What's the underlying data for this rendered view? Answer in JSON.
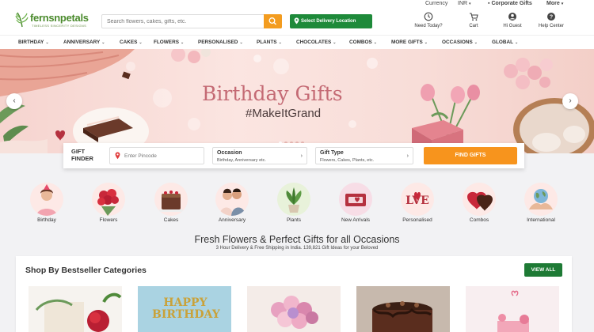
{
  "top_strip": {
    "currency_label": "Currency",
    "currency_value": "INR",
    "corporate": "Corporate Gifts",
    "more": "More"
  },
  "header": {
    "logo_text": "fernsnpetals",
    "logo_tagline": "TIMELESS SINCERITY DESIGNS",
    "search_placeholder": "Search flowers, cakes, gifts, etc.",
    "delivery_label": "Select Delivery Location",
    "actions": [
      {
        "label": "Need Today?",
        "icon": "clock-icon"
      },
      {
        "label": "Cart",
        "icon": "cart-icon"
      },
      {
        "label": "Hi Guest",
        "icon": "user-icon"
      },
      {
        "label": "Help Center",
        "icon": "help-icon"
      }
    ]
  },
  "nav": {
    "items": [
      "BIRTHDAY",
      "ANNIVERSARY",
      "CAKES",
      "FLOWERS",
      "PERSONALISED",
      "PLANTS",
      "CHOCOLATES",
      "COMBOS",
      "MORE GIFTS",
      "OCCASIONS",
      "GLOBAL"
    ]
  },
  "hero": {
    "title": "Birthday Gifts",
    "subtitle": "#MakeItGrand",
    "active_slide": 1,
    "slide_count": 5
  },
  "finder": {
    "title_line1": "GIFT",
    "title_line2": "FINDER",
    "pincode_placeholder": "Enter Pincode",
    "occasion_label": "Occasion",
    "occasion_value": "Birthday, Anniversary etc.",
    "gifttype_label": "Gift Type",
    "gifttype_value": "Flowers, Cakes, Plants, etc.",
    "button": "FIND GIFTS"
  },
  "categories": [
    {
      "label": "Birthday"
    },
    {
      "label": "Flowers"
    },
    {
      "label": "Cakes"
    },
    {
      "label": "Anniversary"
    },
    {
      "label": "Plants"
    },
    {
      "label": "New Arrivals"
    },
    {
      "label": "Personalised"
    },
    {
      "label": "Combos"
    },
    {
      "label": "International"
    }
  ],
  "tagline": {
    "heading": "Fresh Flowers & Perfect Gifts for all Occasions",
    "sub": "3 Hour Delivery & Free Shipping in India. 139,821 Gift Ideas for your Beloved"
  },
  "bestseller": {
    "title": "Shop By Bestseller Categories",
    "view_all": "VIEW ALL",
    "card_text": "HAPPY BIRTHDAY"
  },
  "colors": {
    "brand_green": "#4a8a2c",
    "search_orange": "#f39c1f",
    "delivery_green": "#1e8a3a",
    "find_orange": "#f7941d",
    "hero_title": "#c46a74",
    "viewall_green": "#1e7a35"
  }
}
